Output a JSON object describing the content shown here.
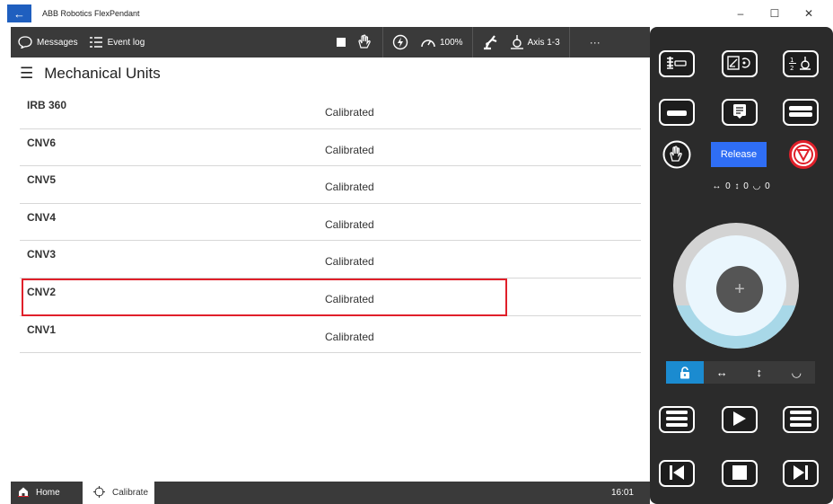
{
  "window": {
    "title": "ABB Robotics FlexPendant",
    "back_icon": "arrow-left-icon",
    "controls": [
      "–",
      "☐",
      "✕"
    ]
  },
  "toolbar": {
    "messages_label": "Messages",
    "event_log_label": "Event log",
    "speed_label": "100%",
    "axis_label": "Axis 1-3",
    "more_label": "···"
  },
  "page": {
    "title": "Mechanical Units"
  },
  "units": [
    {
      "name": "IRB 360",
      "status": "Calibrated"
    },
    {
      "name": "CNV6",
      "status": "Calibrated"
    },
    {
      "name": "CNV5",
      "status": "Calibrated"
    },
    {
      "name": "CNV4",
      "status": "Calibrated"
    },
    {
      "name": "CNV3",
      "status": "Calibrated"
    },
    {
      "name": "CNV2",
      "status": "Calibrated"
    },
    {
      "name": "CNV1",
      "status": "Calibrated"
    }
  ],
  "taskbar": {
    "home_label": "Home",
    "calibrate_label": "Calibrate",
    "time": "16:01"
  },
  "panel": {
    "release_label": "Release",
    "readout": "↔ 0  ↕ 0  ◡ 0"
  },
  "colors": {
    "accent": "#2f6ef5",
    "highlight": "#e0202a",
    "toolbar_bg": "#3a3a3a"
  }
}
